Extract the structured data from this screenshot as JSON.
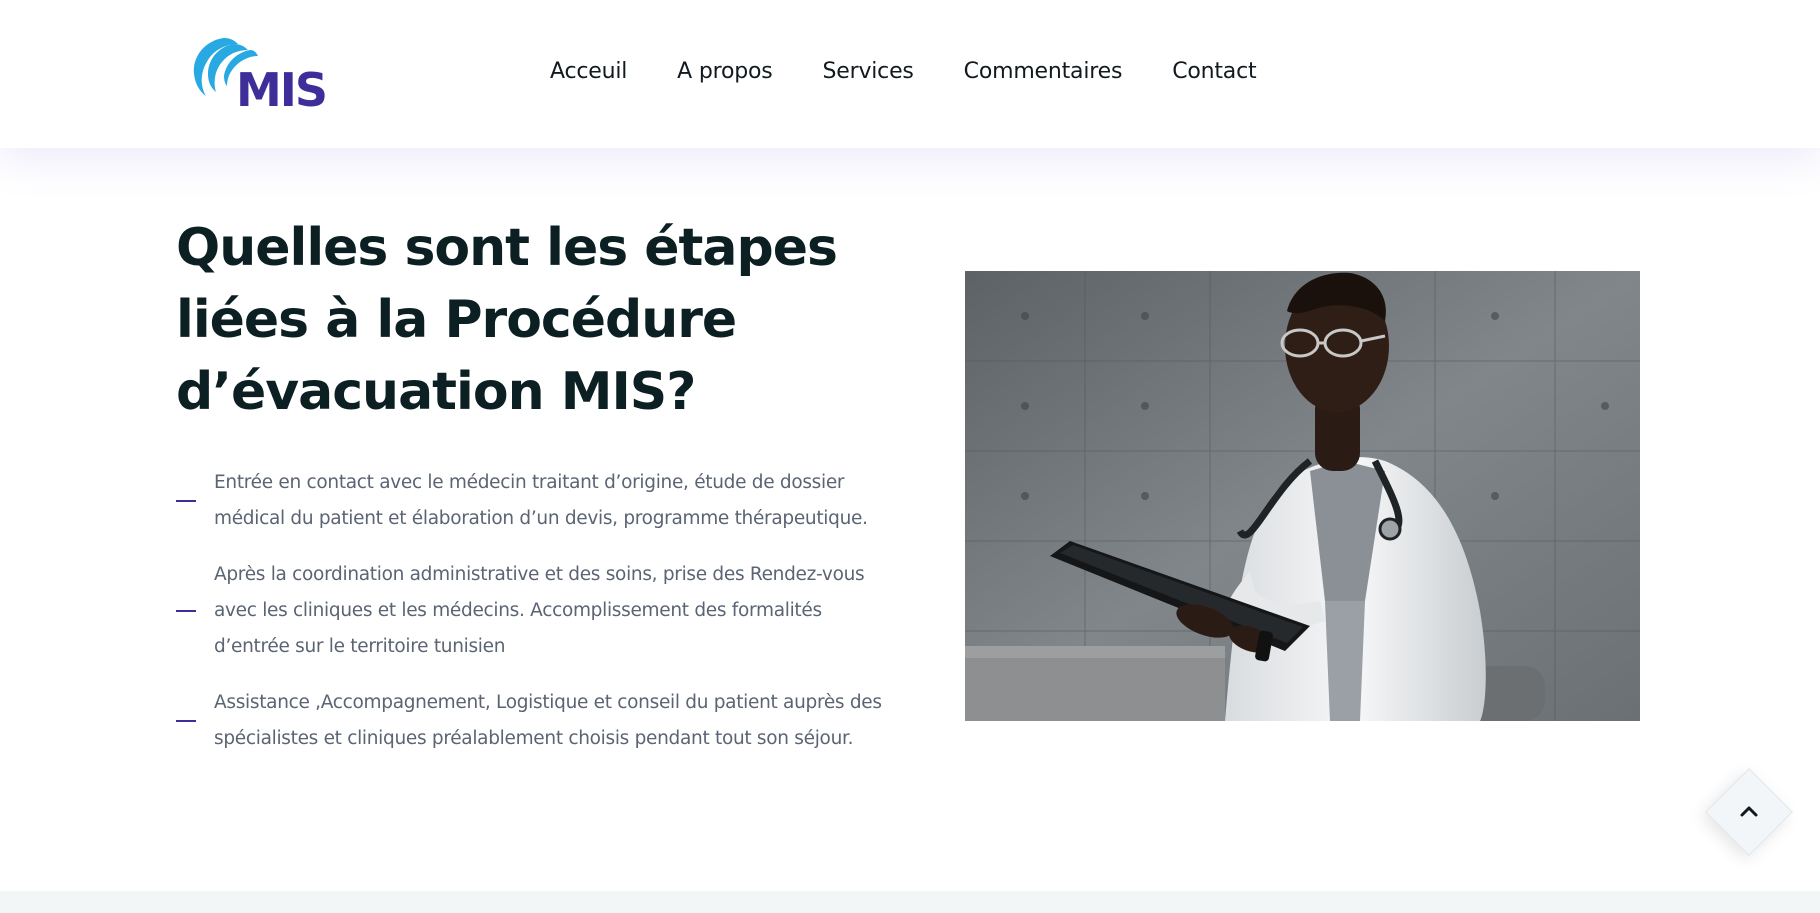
{
  "brand": {
    "name": "MIS",
    "primary_color": "#3d2e9a",
    "accent_color": "#29a9e1"
  },
  "nav": {
    "items": [
      {
        "label": "Acceuil"
      },
      {
        "label": "A propos"
      },
      {
        "label": "Services"
      },
      {
        "label": "Commentaires"
      },
      {
        "label": "Contact"
      }
    ]
  },
  "main": {
    "title": "Quelles sont les étapes liées à la Procédure d’évacuation MIS?",
    "steps": [
      {
        "text": "Entrée en contact avec le médecin traitant d’origine, étude de dossier médical du patient et élaboration d’un devis, programme thérapeutique."
      },
      {
        "text": "Après la coordination administrative et des soins, prise des Rendez-vous avec les cliniques et les médecins. Accomplissement des formalités d’entrée sur le territoire tunisien"
      },
      {
        "text": "Assistance ,Accompagnement, Logistique et conseil du patient auprès des spécialistes et cliniques préalablement choisis pendant tout son séjour."
      }
    ],
    "image": {
      "subject": "doctor-with-tablet"
    }
  },
  "scroll_top": {
    "icon": "chevron-up-icon"
  }
}
